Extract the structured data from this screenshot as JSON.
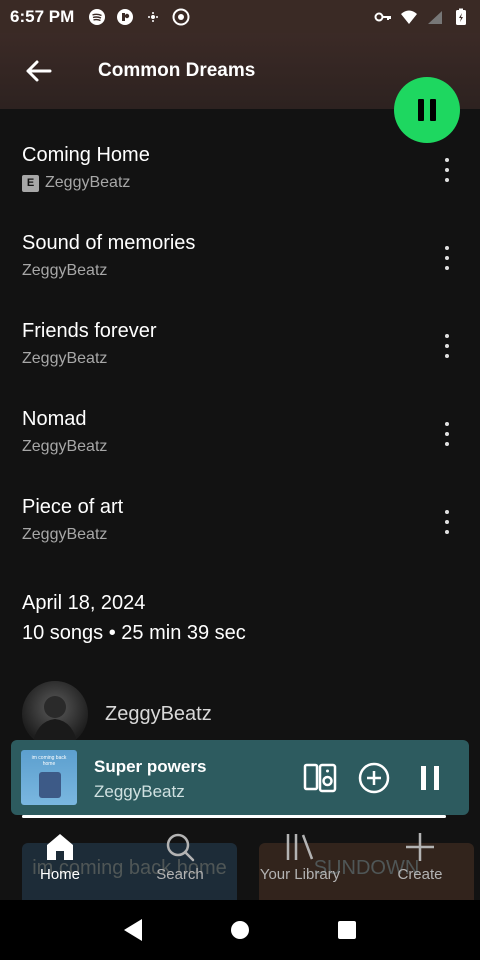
{
  "status_bar": {
    "time": "6:57 PM"
  },
  "header": {
    "title": "Common Dreams"
  },
  "tracks": [
    {
      "title": "Coming Home",
      "artist": "ZeggyBeatz",
      "explicit": true,
      "explicit_label": "E"
    },
    {
      "title": "Sound of memories",
      "artist": "ZeggyBeatz",
      "explicit": false
    },
    {
      "title": "Friends forever",
      "artist": "ZeggyBeatz",
      "explicit": false
    },
    {
      "title": "Nomad",
      "artist": "ZeggyBeatz",
      "explicit": false
    },
    {
      "title": "Piece of art",
      "artist": "ZeggyBeatz",
      "explicit": false
    }
  ],
  "release": {
    "date": "April 18, 2024",
    "meta": "10 songs • 25 min 39 sec"
  },
  "artist": {
    "name": "ZeggyBeatz"
  },
  "mini_player": {
    "title": "Super powers",
    "artist": "ZeggyBeatz",
    "art_text": "im coming back home",
    "progress": 1.0
  },
  "bottom_nav": {
    "items": [
      {
        "label": "Home",
        "icon": "home-icon",
        "active": true
      },
      {
        "label": "Search",
        "icon": "search-icon",
        "active": false
      },
      {
        "label": "Your Library",
        "icon": "library-icon",
        "active": false
      },
      {
        "label": "Create",
        "icon": "plus-icon",
        "active": false
      }
    ],
    "bg_card_left": "im coming back home",
    "bg_card_right": "SUNDOWN"
  },
  "colors": {
    "accent": "#1ed760",
    "background": "#121212",
    "mini_player_bg": "#2d5b5f",
    "header_bg": "#3b2a26"
  }
}
